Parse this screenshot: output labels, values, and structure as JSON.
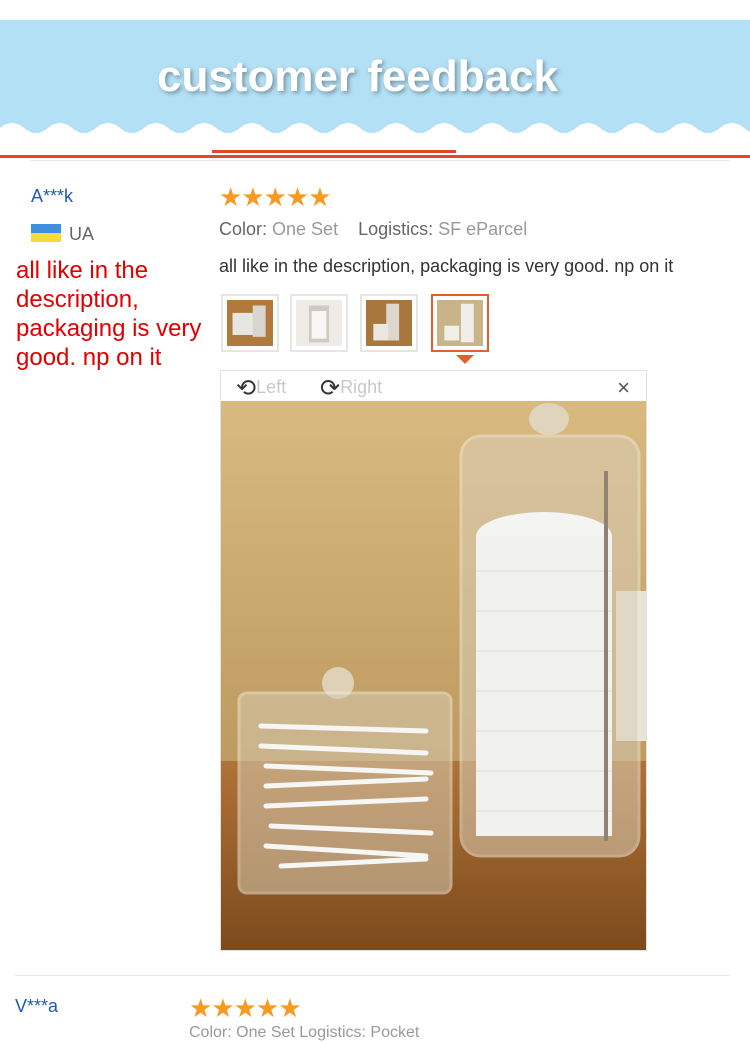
{
  "banner": {
    "title": "customer feedback"
  },
  "reviews": [
    {
      "user": "A***k",
      "country": "UA",
      "note": "all like in the description, packaging is very good. np on it",
      "stars": "★★★★★",
      "color_label": "Color:",
      "color_value": "One Set",
      "logistics_label": "Logistics:",
      "logistics_value": "SF eParcel",
      "text": "all like in the description, packaging is very good. np on it",
      "viewer": {
        "left_label": "Left",
        "right_label": "Right",
        "close": "×"
      }
    },
    {
      "user": "V***a",
      "stars": "★★★★★",
      "meta_partial": "Color: One Set   Logistics: Pocket"
    }
  ],
  "colors": {
    "banner": "#b3e0f5",
    "accent": "#e0482b",
    "star": "#f79a21",
    "user": "#1d59b7",
    "note": "#e00000"
  },
  "icons": [
    "rotate-left-icon",
    "rotate-right-icon",
    "close-icon",
    "ukraine-flag-icon",
    "star-icon"
  ]
}
